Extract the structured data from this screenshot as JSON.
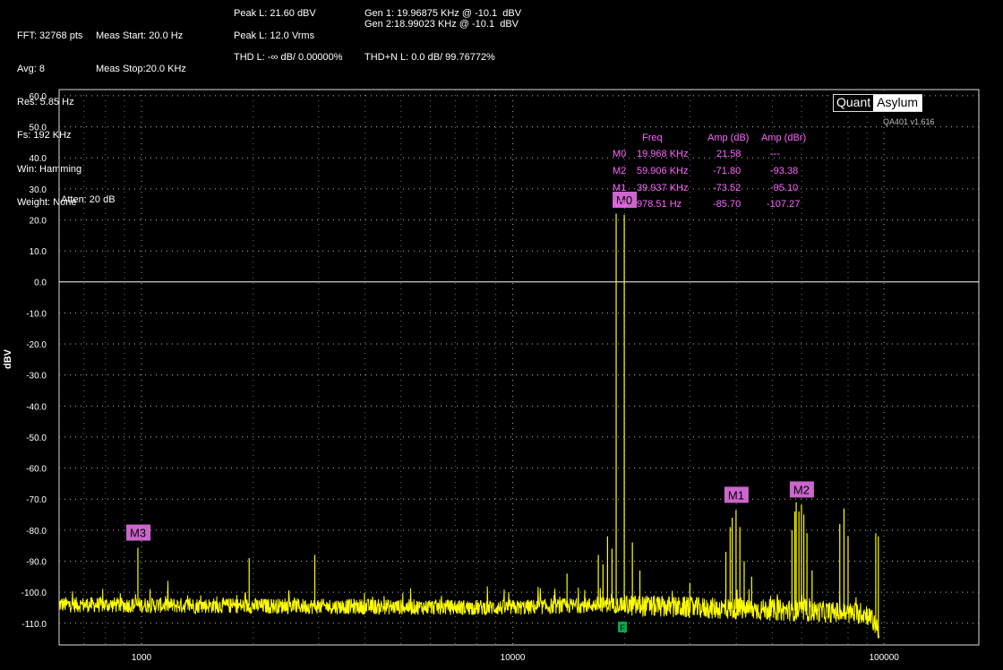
{
  "header": {
    "col1": [
      "FFT: 32768 pts",
      "Avg: 8",
      "Res: 5.85 Hz",
      "Fs: 192 KHz",
      "Win: Hamming",
      "Weight: None"
    ],
    "col2": [
      "Meas Start: 20.0 Hz",
      "Meas Stop:20.0 KHz"
    ],
    "peak_dbv": "Peak L: 21.60 dBV",
    "peak_vrms": "Peak L: 12.0 Vrms",
    "thd": "THD L: -∞ dB/ 0.00000%",
    "thdn": "THD+N L: 0.0 dB/ 99.76772%",
    "gen1": "Gen 1: 19.96875 KHz @ -10.1  dBV",
    "gen2": "Gen 2:18.99023 KHz @ -10.1  dBV"
  },
  "logo": {
    "left": "Quant",
    "right": "Asylum",
    "version": "QA401 v1.616"
  },
  "atten": "Atten: 20 dB",
  "y_axis_label": "dBV",
  "marker_table": {
    "headers": [
      "Freq",
      "Amp (dB)",
      "Amp (dBr)"
    ],
    "rows": [
      {
        "id": "M0",
        "freq": "19.968 KHz",
        "amp": "21.58",
        "dbr": "---"
      },
      {
        "id": "M2",
        "freq": "59.906 KHz",
        "amp": "-71.80",
        "dbr": "-93.38"
      },
      {
        "id": "M1",
        "freq": "39.937 KHz",
        "amp": "-73.52",
        "dbr": "-95.10"
      },
      {
        "id": "M3",
        "freq": "978.51 Hz",
        "amp": "-85.70",
        "dbr": "-107.27"
      }
    ]
  },
  "markers": [
    {
      "id": "M0",
      "freq_hz": 19968,
      "amp_db": 21.58
    },
    {
      "id": "M1",
      "freq_hz": 39937,
      "amp_db": -73.52
    },
    {
      "id": "M2",
      "freq_hz": 59906,
      "amp_db": -71.8
    },
    {
      "id": "M3",
      "freq_hz": 978.51,
      "amp_db": -85.7
    }
  ],
  "ref_marker_label": "F",
  "colors": {
    "trace": "#ffff00",
    "marker_bg": "#cc66cc",
    "marker_text": "#ff66ff",
    "grid": "#bbbbbb",
    "ref_marker": "#00aa44"
  },
  "chart_data": {
    "type": "line",
    "xscale": "log",
    "xlim": [
      600,
      180000
    ],
    "ylim": [
      -117,
      62
    ],
    "y_ticks": [
      "60.0",
      "50.0",
      "40.0",
      "30.0",
      "20.0",
      "10.0",
      "0.0",
      "-10.0",
      "-20.0",
      "-30.0",
      "-40.0",
      "-50.0",
      "-60.0",
      "-70.0",
      "-80.0",
      "-90.0",
      "-100.0",
      "-110.0"
    ],
    "x_ticks": [
      "1000",
      "10000",
      "100000"
    ],
    "ylabel": "dBV",
    "grid": true,
    "spikes": [
      {
        "x": 978,
        "y": -85.7
      },
      {
        "x": 1950,
        "y": -89
      },
      {
        "x": 2930,
        "y": -88
      },
      {
        "x": 14000,
        "y": -94
      },
      {
        "x": 17000,
        "y": -88
      },
      {
        "x": 17500,
        "y": -91
      },
      {
        "x": 18000,
        "y": -82
      },
      {
        "x": 18500,
        "y": -86
      },
      {
        "x": 18990,
        "y": 22
      },
      {
        "x": 19968,
        "y": 21.6
      },
      {
        "x": 21000,
        "y": -84
      },
      {
        "x": 22000,
        "y": -93
      },
      {
        "x": 30000,
        "y": -97
      },
      {
        "x": 37500,
        "y": -87
      },
      {
        "x": 38500,
        "y": -79
      },
      {
        "x": 39000,
        "y": -76
      },
      {
        "x": 39937,
        "y": -73.5
      },
      {
        "x": 40900,
        "y": -79
      },
      {
        "x": 42000,
        "y": -90
      },
      {
        "x": 44000,
        "y": -95
      },
      {
        "x": 56500,
        "y": -80
      },
      {
        "x": 57500,
        "y": -74
      },
      {
        "x": 58000,
        "y": -71
      },
      {
        "x": 59000,
        "y": -74
      },
      {
        "x": 59906,
        "y": -71.8
      },
      {
        "x": 60800,
        "y": -75
      },
      {
        "x": 62000,
        "y": -81
      },
      {
        "x": 64000,
        "y": -93
      },
      {
        "x": 76000,
        "y": -78
      },
      {
        "x": 78000,
        "y": -73
      },
      {
        "x": 80000,
        "y": -82
      },
      {
        "x": 95000,
        "y": -81
      },
      {
        "x": 96500,
        "y": -82
      }
    ],
    "noise_floor": [
      {
        "x": 600,
        "y": -104
      },
      {
        "x": 10000,
        "y": -105
      },
      {
        "x": 18000,
        "y": -104
      },
      {
        "x": 30000,
        "y": -105
      },
      {
        "x": 60000,
        "y": -106
      },
      {
        "x": 90000,
        "y": -107
      },
      {
        "x": 97000,
        "y": -112
      }
    ]
  }
}
